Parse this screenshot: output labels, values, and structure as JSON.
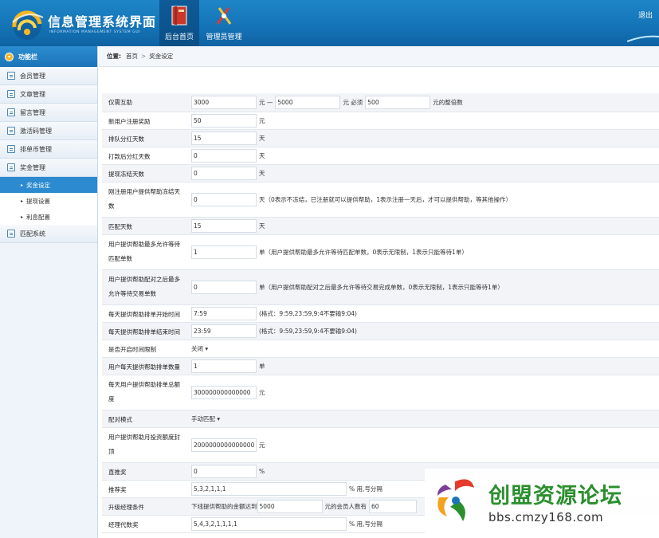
{
  "header": {
    "title": "信息管理系统界面",
    "subtitle": "INFORMATION MANAGEMENT SYSTEM GUI",
    "nav": [
      {
        "label": "后台首页"
      },
      {
        "label": "管理员管理"
      }
    ],
    "logout": "退出"
  },
  "sidebar": {
    "title": "功能栏",
    "items": [
      {
        "label": "会员管理"
      },
      {
        "label": "文章管理"
      },
      {
        "label": "留言管理"
      },
      {
        "label": "激活码管理"
      },
      {
        "label": "排单币管理"
      },
      {
        "label": "奖金管理"
      }
    ],
    "subitems": [
      {
        "label": "奖金设定"
      },
      {
        "label": "提现设置"
      },
      {
        "label": "利息配置"
      }
    ],
    "last_item": {
      "label": "匹配系统"
    }
  },
  "breadcrumb": {
    "label": "位置:",
    "home": "首页",
    "sep": ">",
    "current": "奖金设定"
  },
  "form": {
    "r1": {
      "label": "仅需互助",
      "v1": "3000",
      "t1": "元 —",
      "v2": "5000",
      "t2": "元 必须",
      "v3": "500",
      "t3": "元的整倍数"
    },
    "r2": {
      "label": "新用户注册奖励",
      "v1": "50",
      "t1": "元"
    },
    "r3": {
      "label": "排队分红天数",
      "v1": "15",
      "t1": "天"
    },
    "r4": {
      "label": "打款后分红天数",
      "v1": "0",
      "t1": "天"
    },
    "r5": {
      "label": "提现冻结天数",
      "v1": "0",
      "t1": "天"
    },
    "r6": {
      "label": "刚注册用户提供帮助冻结天数",
      "v1": "0",
      "t1": "天（0表示不冻结，已注册就可以提供帮助，1表示注册一天后，才可以提供帮助，等其他操作）"
    },
    "r7": {
      "label": "匹配天数",
      "v1": "15",
      "t1": "天"
    },
    "r8": {
      "label": "用户提供帮助最多允许等待匹配单数",
      "v1": "1",
      "t1": "单（用户提供帮助最多允许等待匹配单数，0表示无限制，1表示只能等待1单）"
    },
    "r9": {
      "label": "用户提供帮助配对之后最多允许等待交易单数",
      "v1": "0",
      "t1": "单（用户提供帮助配对之后最多允许等待交易完成单数，0表示无限制，1表示只能等待1单）"
    },
    "r10": {
      "label": "每天提供帮助排单开始时间",
      "v1": "7:59",
      "t1": "(格式：9:59,23:59,9:4不要输9:04)"
    },
    "r11": {
      "label": "每天提供帮助排单结束时间",
      "v1": "23:59",
      "t1": "(格式：9:59,23:59,9:4不要输9:04)"
    },
    "r12": {
      "label": "是否开启时间限制",
      "sel": "关闭 ▾"
    },
    "r13": {
      "label": "用户每天提供帮助排单数量",
      "v1": "1",
      "t1": "单"
    },
    "r14": {
      "label": "每天用户提供帮助排单总额度",
      "v1": "300000000000000",
      "t1": "元"
    },
    "r15": {
      "label": "配对模式",
      "sel": "手动匹配 ▾"
    },
    "r16": {
      "label": "用户提供帮助月投资额度封顶",
      "v1": "2000000000000000",
      "t1": "元"
    },
    "r17": {
      "label": "直推奖",
      "v1": "0",
      "t1": "%"
    },
    "r18": {
      "label": "推荐奖",
      "v1": "5,3,2,1,1,1",
      "t1": "% 用,号分隔"
    },
    "r19": {
      "label": "升级经理条件",
      "t0": "下线提供帮助的金额达到",
      "v1": "5000",
      "t1": "元的会员人数有",
      "v2": "60"
    },
    "r20": {
      "label": "经理代数奖",
      "v1": "5,4,3,2,1,1,1,1",
      "t1": "% 用,号分隔"
    }
  },
  "watermark": {
    "title": "创盟资源论坛",
    "url": "bbs.cmzy168.com"
  },
  "colors": {
    "header": "#1576b9",
    "active": "#2b8ad0",
    "watermark_green": "#2b8f2e"
  }
}
